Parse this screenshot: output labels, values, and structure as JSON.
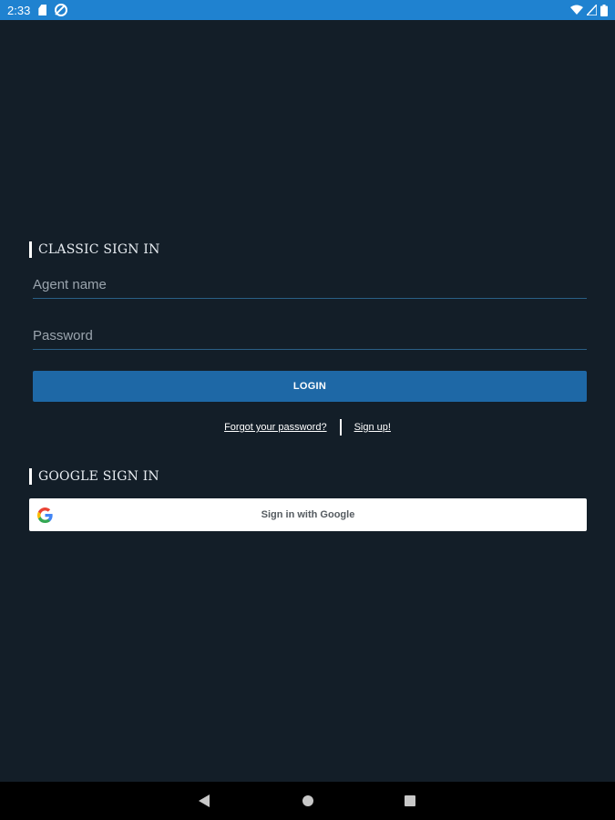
{
  "status_bar": {
    "time": "2:33",
    "icons": [
      "sd-card-icon",
      "sync-disabled-icon",
      "wifi-icon",
      "signal-icon",
      "battery-icon"
    ]
  },
  "classic_sign_in": {
    "title": "CLASSIC SIGN IN",
    "agent_name_placeholder": "Agent name",
    "agent_name_value": "",
    "password_placeholder": "Password",
    "password_value": "",
    "login_label": "LOGIN",
    "forgot_password_label": "Forgot your password?",
    "sign_up_label": "Sign up!"
  },
  "google_sign_in": {
    "title": "GOOGLE SIGN IN",
    "button_label": "Sign in with Google"
  },
  "colors": {
    "background": "#131e28",
    "status_bar": "#1f82d0",
    "accent": "#1e68a6"
  },
  "nav_bar": {
    "buttons": [
      "back-icon",
      "home-icon",
      "recents-icon"
    ]
  }
}
